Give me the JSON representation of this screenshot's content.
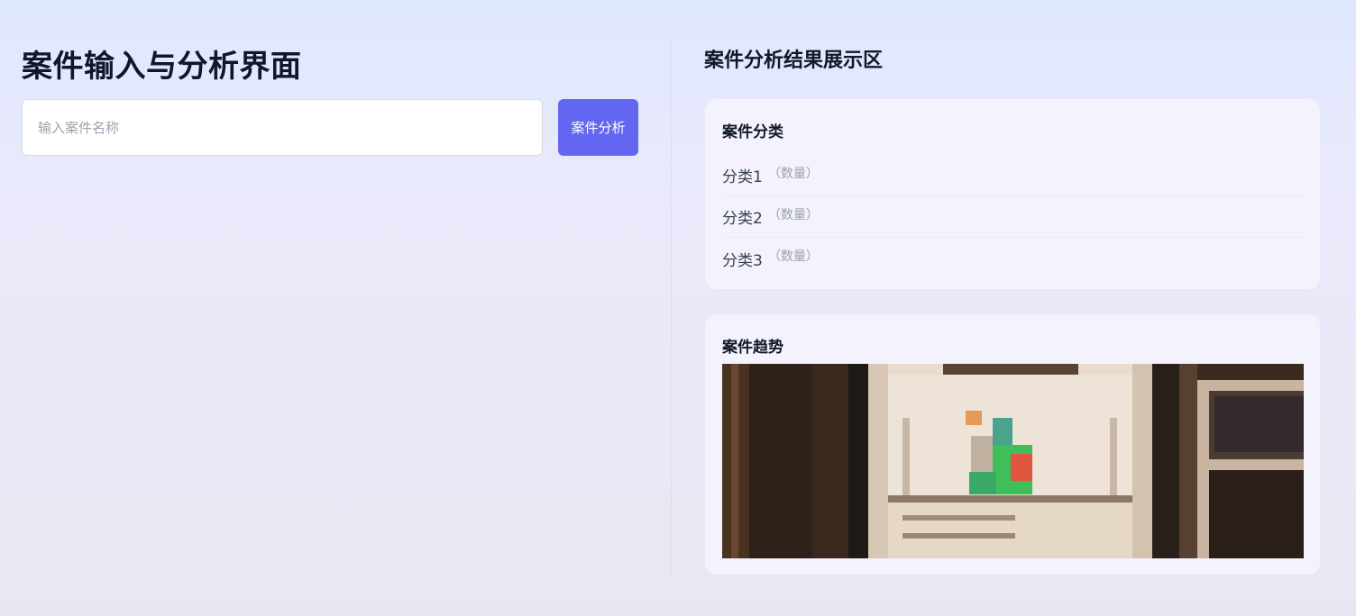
{
  "left_panel": {
    "title": "案件输入与分析界面",
    "input": {
      "placeholder": "输入案件名称",
      "value": ""
    },
    "analyze_button": "案件分析"
  },
  "right_panel": {
    "title": "案件分析结果展示区",
    "category_card": {
      "title": "案件分类",
      "items": [
        {
          "name": "分类1",
          "count": "（数量）"
        },
        {
          "name": "分类2",
          "count": "（数量）"
        },
        {
          "name": "分类3",
          "count": "（数量）"
        }
      ]
    },
    "trend_card": {
      "title": "案件趋势"
    }
  }
}
